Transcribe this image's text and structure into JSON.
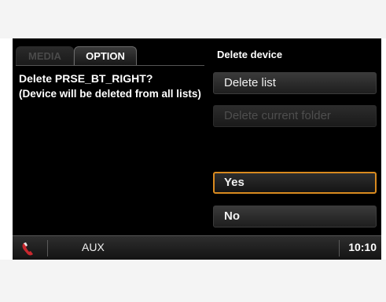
{
  "tabs": [
    {
      "label": "MEDIA",
      "active": false
    },
    {
      "label": "OPTION",
      "active": true
    }
  ],
  "message": {
    "line1": "Delete PRSE_BT_RIGHT?",
    "line2": "(Device will be deleted from all lists)"
  },
  "menu": {
    "heading": "Delete device",
    "items": [
      {
        "label": "Delete list",
        "enabled": true
      },
      {
        "label": "Delete current folder",
        "enabled": false
      }
    ]
  },
  "dialog": {
    "yes_label": "Yes",
    "no_label": "No",
    "selected": "Yes"
  },
  "status": {
    "phone_icon": "phone-icon",
    "source": "AUX",
    "time": "10:10"
  },
  "colors": {
    "accent": "#d98a1f",
    "background": "#000000"
  }
}
